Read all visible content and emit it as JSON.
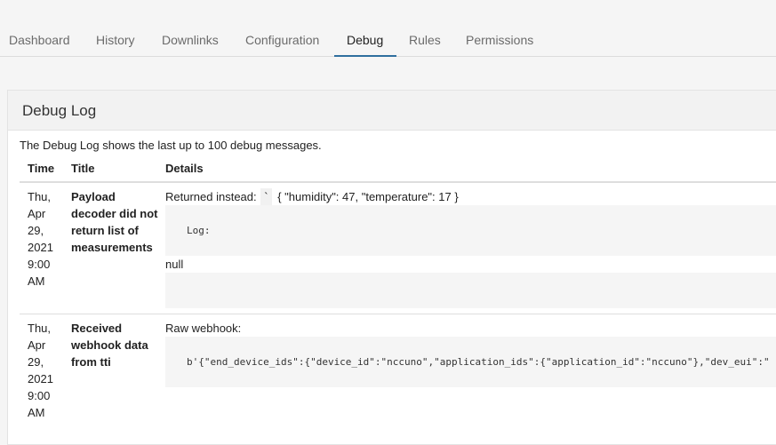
{
  "tabs": [
    {
      "label": "Dashboard"
    },
    {
      "label": "History"
    },
    {
      "label": "Downlinks"
    },
    {
      "label": "Configuration"
    },
    {
      "label": "Debug",
      "active": true
    },
    {
      "label": "Rules"
    },
    {
      "label": "Permissions"
    }
  ],
  "card": {
    "title": "Debug Log",
    "intro": "The Debug Log shows the last up to 100 debug messages."
  },
  "table": {
    "headers": [
      "Time",
      "Title",
      "Details"
    ],
    "rows": [
      {
        "time": [
          "Thu,",
          "Apr",
          "29,",
          "2021",
          "9:00",
          "AM"
        ],
        "title": "Payload decoder did not return list of measurements",
        "detail_prefix": "Returned instead:",
        "tick": "`",
        "returned_value": "{ \"humidity\": 47, \"temperature\": 17 }",
        "log_label": "Log:",
        "null_text": "null"
      },
      {
        "time": [
          "Thu,",
          "Apr",
          "29,",
          "2021",
          "9:00",
          "AM"
        ],
        "title": "Received webhook data from tti",
        "detail_prefix": "Raw webhook:",
        "raw": "b'{\"end_device_ids\":{\"device_id\":\"nccuno\",\"application_ids\":{\"application_id\":\"nccuno\"},\"dev_eui\":\""
      }
    ]
  },
  "colors": {
    "accent": "#2f6f9e",
    "background": "#f5f5f5",
    "card_header": "#f2f2f2"
  }
}
